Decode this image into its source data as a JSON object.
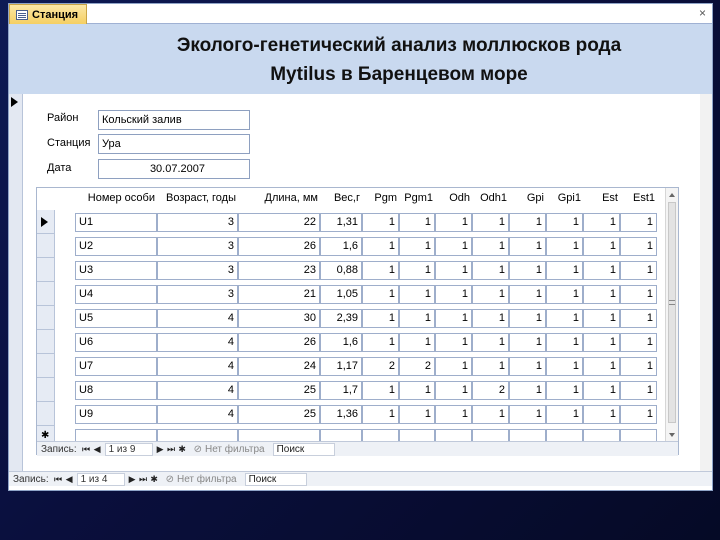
{
  "window": {
    "tab_title": "Станция",
    "close": "×"
  },
  "header": {
    "title_line1": "Эколого-генетический анализ моллюсков рода",
    "title_line2": "Mytilus в Баренцевом море"
  },
  "form": {
    "district_label": "Район",
    "district_value": "Кольский залив",
    "station_label": "Станция",
    "station_value": "Ура",
    "date_label": "Дата",
    "date_value": "30.07.2007"
  },
  "subform": {
    "columns": [
      "Номер особи",
      "Возраст, годы",
      "Длина, мм",
      "Вес,г",
      "Pgm",
      "Pgm1",
      "Odh",
      "Odh1",
      "Gpi",
      "Gpi1",
      "Est",
      "Est1"
    ],
    "rows": [
      [
        "U1",
        "3",
        "22",
        "1,31",
        "1",
        "1",
        "1",
        "1",
        "1",
        "1",
        "1",
        "1"
      ],
      [
        "U2",
        "3",
        "26",
        "1,6",
        "1",
        "1",
        "1",
        "1",
        "1",
        "1",
        "1",
        "1"
      ],
      [
        "U3",
        "3",
        "23",
        "0,88",
        "1",
        "1",
        "1",
        "1",
        "1",
        "1",
        "1",
        "1"
      ],
      [
        "U4",
        "3",
        "21",
        "1,05",
        "1",
        "1",
        "1",
        "1",
        "1",
        "1",
        "1",
        "1"
      ],
      [
        "U5",
        "4",
        "30",
        "2,39",
        "1",
        "1",
        "1",
        "1",
        "1",
        "1",
        "1",
        "1"
      ],
      [
        "U6",
        "4",
        "26",
        "1,6",
        "1",
        "1",
        "1",
        "1",
        "1",
        "1",
        "1",
        "1"
      ],
      [
        "U7",
        "4",
        "24",
        "1,17",
        "2",
        "2",
        "1",
        "1",
        "1",
        "1",
        "1",
        "1"
      ],
      [
        "U8",
        "4",
        "25",
        "1,7",
        "1",
        "1",
        "1",
        "2",
        "1",
        "1",
        "1",
        "1"
      ],
      [
        "U9",
        "4",
        "25",
        "1,36",
        "1",
        "1",
        "1",
        "1",
        "1",
        "1",
        "1",
        "1"
      ]
    ],
    "nav": {
      "label": "Запись:",
      "position": "1 из 9",
      "filter": "Нет фильтра",
      "search": "Поиск"
    }
  },
  "main_nav": {
    "label": "Запись:",
    "position": "1 из 4",
    "filter": "Нет фильтра",
    "search": "Поиск"
  },
  "colors": {
    "header_bg": "#c9d9ef",
    "tab_bg": "#f5cf62",
    "desktop_bg": "#0a0f3d"
  },
  "icons": {
    "first": "first-record-icon",
    "prev": "prev-record-icon",
    "next": "next-record-icon",
    "last": "last-record-icon",
    "new": "new-record-icon",
    "filter": "filter-icon"
  }
}
